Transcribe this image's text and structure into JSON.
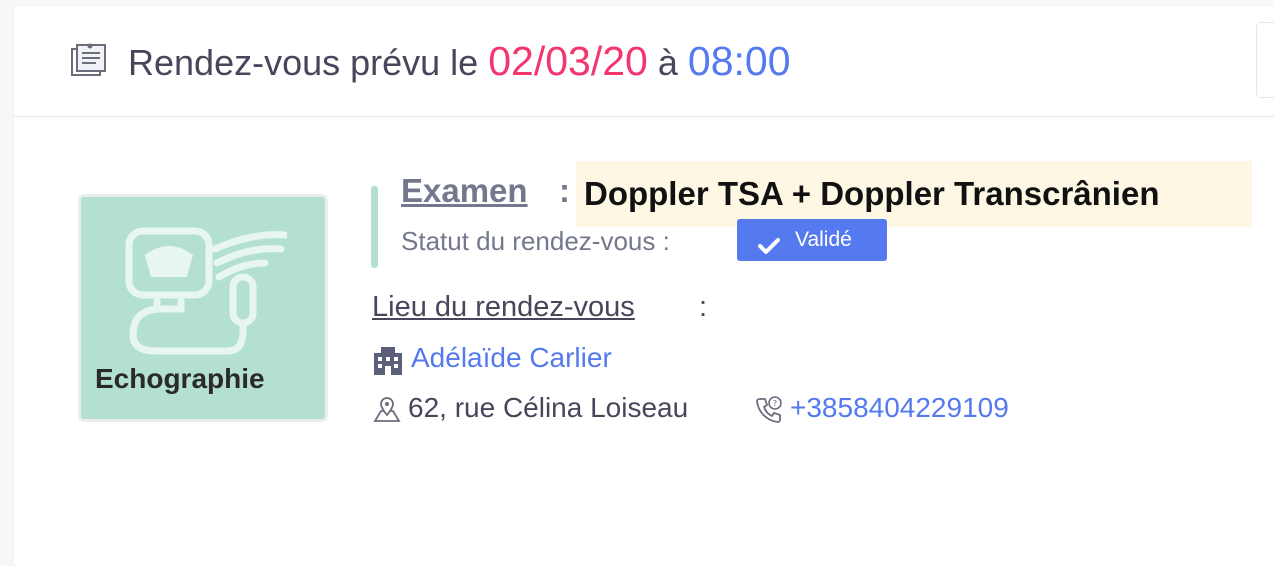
{
  "header": {
    "prefix": "Rendez-vous prévu le",
    "date": "02/03/20",
    "connector": "à",
    "time": "08:00",
    "icon": "notepad-icon"
  },
  "exam": {
    "category": "Echographie",
    "label": "Examen",
    "colon": ":",
    "value": "Doppler TSA + Doppler Transcrânien",
    "status_label": "Statut du rendez-vous :",
    "status_value": "Validé",
    "status_icon": "check-icon"
  },
  "location": {
    "label": "Lieu du rendez-vous",
    "colon": ":",
    "place": "Adélaïde Carlier",
    "address": "62, rue Célina Loiseau",
    "phone": "+3858404229109"
  },
  "colors": {
    "accent_blue": "#5579ee",
    "accent_pink": "#f4366f",
    "mint": "#b4e0d2",
    "highlight": "#fdf7e3"
  }
}
